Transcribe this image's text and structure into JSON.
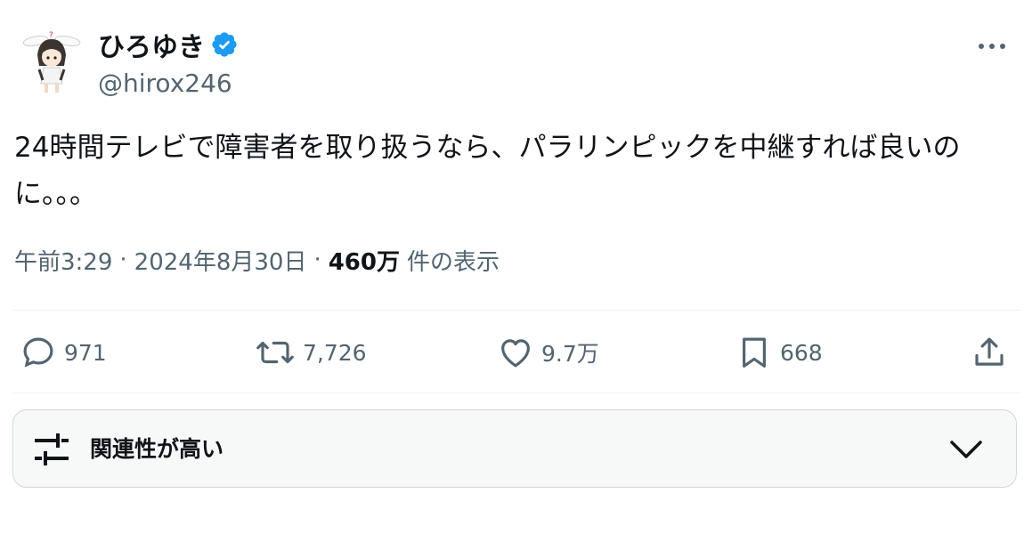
{
  "author": {
    "display_name": "ひろゆき",
    "handle": "@hirox246",
    "verified": true,
    "avatar_icon": "anime-avatar-icon"
  },
  "tweet": {
    "text": "24時間テレビで障害者を取り扱うなら、パラリンピックを中継すれば良いのに。。。",
    "time": "午前3:29",
    "date": "2024年8月30日",
    "views_count": "460万",
    "views_label": "件の表示"
  },
  "actions": {
    "replies": "971",
    "reposts": "7,726",
    "likes": "9.7万",
    "bookmarks": "668"
  },
  "sort": {
    "label": "関連性が高い"
  },
  "colors": {
    "text_primary": "#0f1419",
    "text_secondary": "#536471",
    "verified_blue": "#1d9bf0",
    "divider": "#eff3f4",
    "sort_bg": "#f7f9f9"
  }
}
